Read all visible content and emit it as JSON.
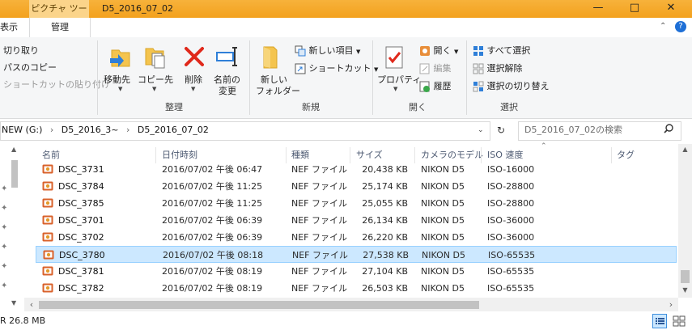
{
  "window": {
    "context_tab": "ピクチャ ツール",
    "title": "D5_2016_07_02"
  },
  "ribbon_tabs": {
    "view_partial": "表示",
    "manage": "管理"
  },
  "ribbon": {
    "clipboard": {
      "cut": "切り取り",
      "copy_path": "パスのコピー",
      "paste_shortcut": "ショートカットの貼り付け"
    },
    "organize": {
      "move_to": "移動先",
      "copy_to": "コピー先",
      "delete": "削除",
      "rename_1": "名前の",
      "rename_2": "変更",
      "label": "整理"
    },
    "new": {
      "new_folder_1": "新しい",
      "new_folder_2": "フォルダー",
      "new_item": "新しい項目",
      "shortcut": "ショートカット",
      "label": "新規"
    },
    "open": {
      "properties": "プロパティ",
      "open": "開く",
      "edit": "編集",
      "history": "履歴",
      "label": "開く"
    },
    "select": {
      "select_all": "すべて選択",
      "select_none": "選択解除",
      "invert": "選択の切り替え",
      "label": "選択"
    }
  },
  "address": {
    "path": [
      "NEW (G:)",
      "D5_2016_3~",
      "D5_2016_07_02"
    ],
    "sep": "›",
    "search_placeholder": "D5_2016_07_02の検索"
  },
  "columns": {
    "name": "名前",
    "date": "日付時刻",
    "type": "種類",
    "size": "サイズ",
    "model": "カメラのモデル",
    "iso": "ISO 速度",
    "tags": "タグ"
  },
  "files": [
    {
      "name": "DSC_3731",
      "date": "2016/07/02 午後 06:47",
      "type": "NEF ファイル",
      "size": "20,438 KB",
      "model": "NIKON D5",
      "iso": "ISO-16000"
    },
    {
      "name": "DSC_3784",
      "date": "2016/07/02 午後 11:25",
      "type": "NEF ファイル",
      "size": "25,174 KB",
      "model": "NIKON D5",
      "iso": "ISO-28800"
    },
    {
      "name": "DSC_3785",
      "date": "2016/07/02 午後 11:25",
      "type": "NEF ファイル",
      "size": "25,055 KB",
      "model": "NIKON D5",
      "iso": "ISO-28800"
    },
    {
      "name": "DSC_3701",
      "date": "2016/07/02 午後 06:39",
      "type": "NEF ファイル",
      "size": "26,134 KB",
      "model": "NIKON D5",
      "iso": "ISO-36000"
    },
    {
      "name": "DSC_3702",
      "date": "2016/07/02 午後 06:39",
      "type": "NEF ファイル",
      "size": "26,220 KB",
      "model": "NIKON D5",
      "iso": "ISO-36000"
    },
    {
      "name": "DSC_3780",
      "date": "2016/07/02 午後 08:18",
      "type": "NEF ファイル",
      "size": "27,538 KB",
      "model": "NIKON D5",
      "iso": "ISO-65535"
    },
    {
      "name": "DSC_3781",
      "date": "2016/07/02 午後 08:19",
      "type": "NEF ファイル",
      "size": "27,104 KB",
      "model": "NIKON D5",
      "iso": "ISO-65535"
    },
    {
      "name": "DSC_3782",
      "date": "2016/07/02 午後 08:19",
      "type": "NEF ファイル",
      "size": "26,503 KB",
      "model": "NIKON D5",
      "iso": "ISO-65535"
    }
  ],
  "selected_index": 5,
  "status": {
    "text": "R  26.8 MB"
  },
  "colors": {
    "titlebar": "#f3a11d",
    "selection": "#cce8ff",
    "selection_border": "#99d1ff",
    "delete_red": "#e0291b",
    "folder_yellow": "#f4c44e",
    "accent_blue": "#1e6fd6"
  },
  "icons": {
    "file": "nef-image-icon",
    "folder": "folder-icon",
    "delete": "delete-x-icon",
    "search": "search-icon"
  }
}
